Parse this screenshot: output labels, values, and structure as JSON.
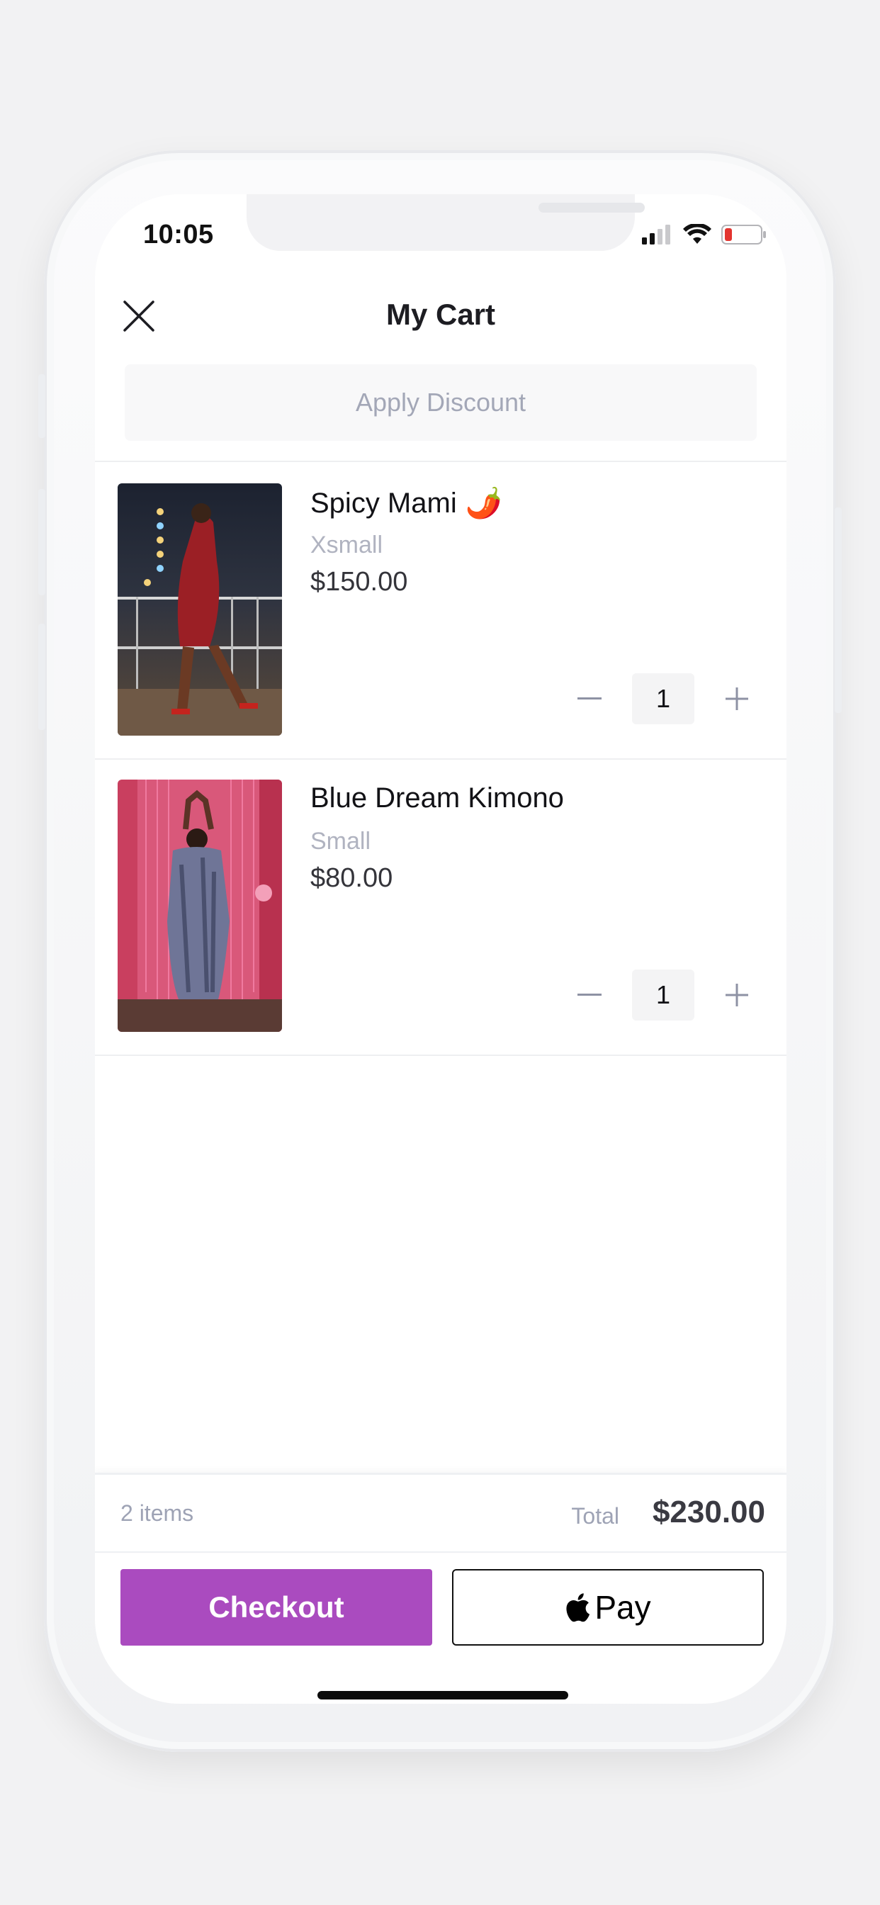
{
  "status_bar": {
    "time": "10:05",
    "icons": [
      "signal-icon",
      "wifi-icon",
      "battery-low-icon"
    ]
  },
  "header": {
    "title": "My Cart",
    "close_icon": "close-icon"
  },
  "discount": {
    "label": "Apply Discount"
  },
  "items": [
    {
      "name": "Spicy Mami",
      "emoji": "🌶️",
      "size": "Xsmall",
      "price": "$150.00",
      "quantity": "1"
    },
    {
      "name": "Blue Dream Kimono",
      "size": "Small",
      "price": "$80.00",
      "quantity": "1"
    }
  ],
  "summary": {
    "items_count": "2 items",
    "total_label": "Total",
    "total_value": "$230.00"
  },
  "actions": {
    "checkout_label": "Checkout",
    "applepay_label": "Pay"
  },
  "colors": {
    "accent": "#aa4bbf",
    "muted_text": "#a3a7b7",
    "background": "#f2f2f3"
  }
}
